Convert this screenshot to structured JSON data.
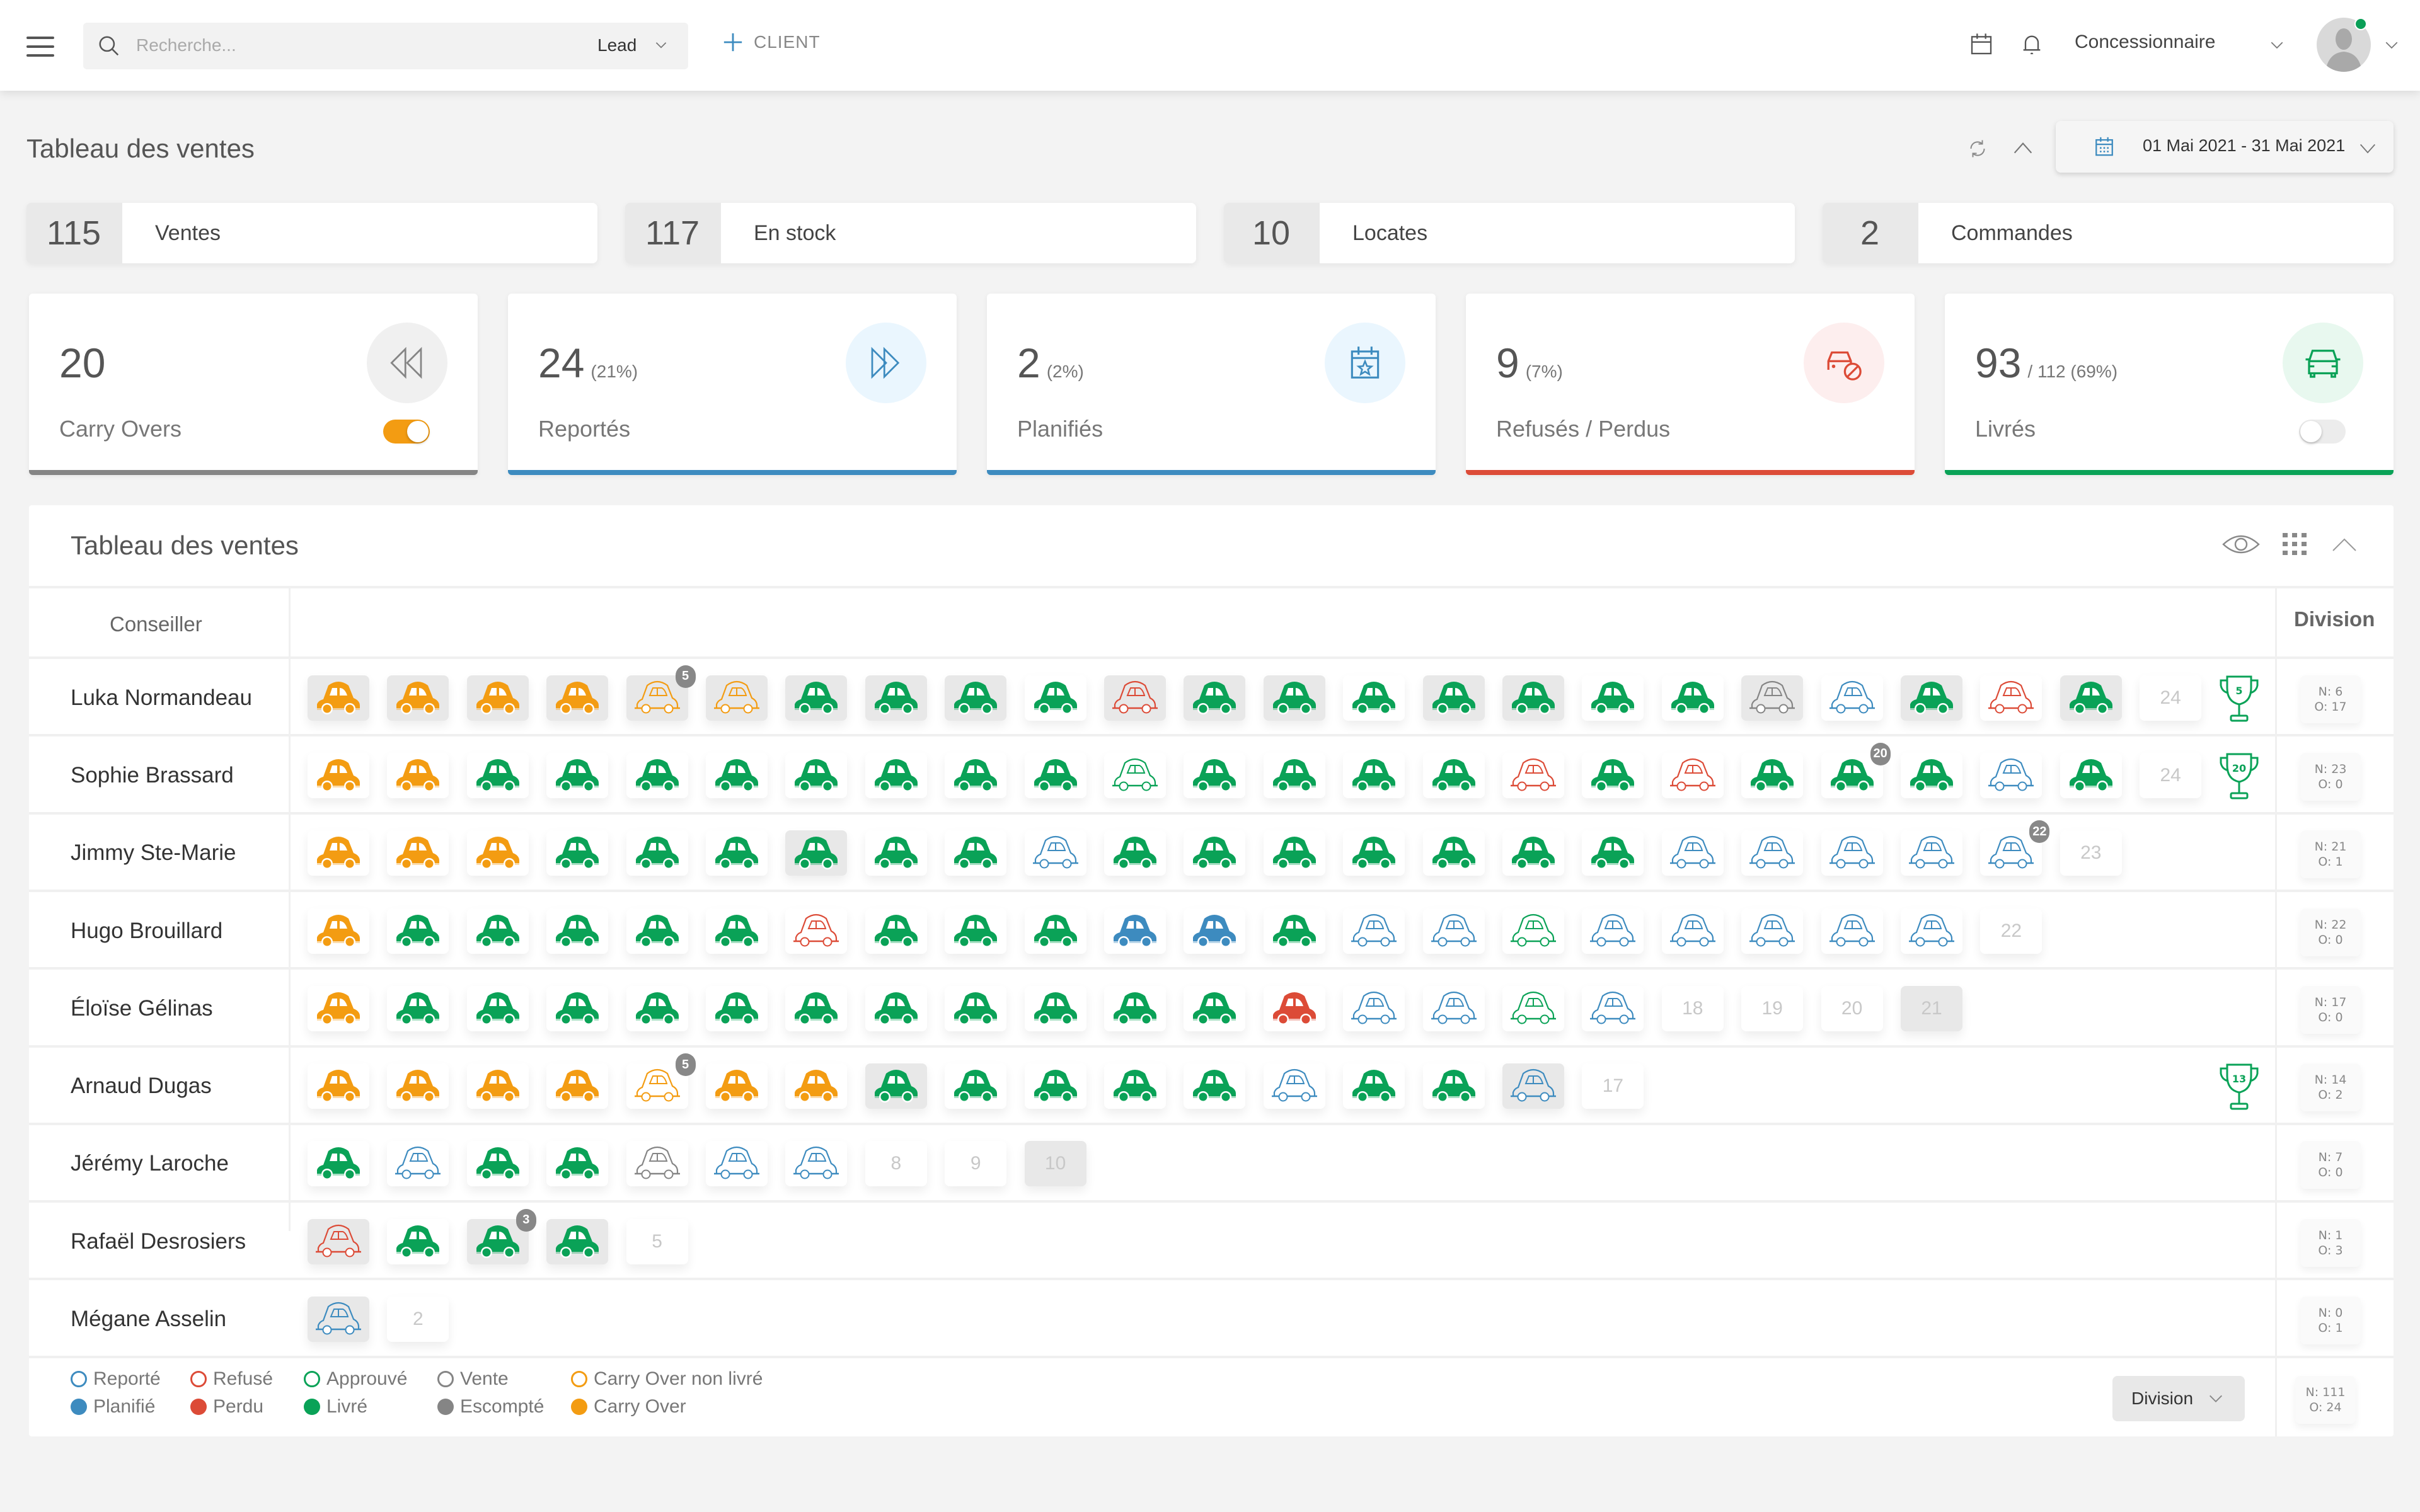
{
  "topbar": {
    "search_placeholder": "Recherche...",
    "search_type": "Lead",
    "add_client_label": "CLIENT",
    "dealer_select": "Concessionnaire"
  },
  "header": {
    "title": "Tableau des ventes",
    "date_range": "01 Mai 2021 - 31 Mai 2021"
  },
  "stats": [
    {
      "value": "115",
      "label": "Ventes"
    },
    {
      "value": "117",
      "label": "En stock"
    },
    {
      "value": "10",
      "label": "Locates"
    },
    {
      "value": "2",
      "label": "Commandes"
    }
  ],
  "kpis": [
    {
      "value": "20",
      "sub": "",
      "label": "Carry Overs",
      "icon": "rewind-icon",
      "color": "#858585",
      "bg": "#f0f0f0",
      "toggle": true,
      "toggle_on": true
    },
    {
      "value": "24",
      "sub": "(21%)",
      "label": "Reportés",
      "icon": "fast-forward-icon",
      "color": "#3d8bbf",
      "bg": "#eaf6fe",
      "toggle": false
    },
    {
      "value": "2",
      "sub": "(2%)",
      "label": "Planifiés",
      "icon": "calendar-star-icon",
      "color": "#3d8bbf",
      "bg": "#eaf6fe",
      "toggle": false
    },
    {
      "value": "9",
      "sub": "(7%)",
      "label": "Refusés / Perdus",
      "icon": "car-cancel-icon",
      "color": "#dc4b37",
      "bg": "#fdeeee",
      "toggle": false
    },
    {
      "value": "93",
      "sub": "/ 112 (69%)",
      "label": "Livrés",
      "icon": "car-front-icon",
      "color": "#0aa257",
      "bg": "#e8f8ef",
      "toggle": true,
      "toggle_on": false
    }
  ],
  "panel": {
    "title": "Tableau des ventes",
    "col_advisor": "Conseiller",
    "col_division": "Division",
    "division_select": "Division"
  },
  "colors": {
    "blue": "#3d8bbf",
    "red": "#dc4b37",
    "green": "#0aa257",
    "gray": "#858585",
    "orange": "#f39c12"
  },
  "legend": [
    {
      "label": "Reporté",
      "color": "blue",
      "filled": false
    },
    {
      "label": "Planifié",
      "color": "blue",
      "filled": true
    },
    {
      "label": "Refusé",
      "color": "red",
      "filled": false
    },
    {
      "label": "Perdu",
      "color": "red",
      "filled": true
    },
    {
      "label": "Approuvé",
      "color": "green",
      "filled": false
    },
    {
      "label": "Livré",
      "color": "green",
      "filled": true
    },
    {
      "label": "Vente",
      "color": "gray",
      "filled": false
    },
    {
      "label": "Escompté",
      "color": "gray",
      "filled": true
    },
    {
      "label": "Carry Over non livré",
      "color": "orange",
      "filled": false
    },
    {
      "label": "Carry Over",
      "color": "orange",
      "filled": true
    }
  ],
  "rows": [
    {
      "name": "Luka Normandeau",
      "division": {
        "n": "N: 6",
        "o": "O: 17"
      },
      "trophy": "5",
      "next": "24",
      "cars": [
        "O*",
        "O*",
        "O*",
        "O*",
        "o*|5",
        "o*",
        "G*",
        "G*",
        "G*",
        "G",
        "r*",
        "G*",
        "G*",
        "G",
        "G*",
        "G*",
        "G",
        "G",
        "v*",
        "b",
        "G*",
        "r",
        "G*"
      ]
    },
    {
      "name": "Sophie Brassard",
      "division": {
        "n": "N: 23",
        "o": "O: 0"
      },
      "trophy": "20",
      "next": "24",
      "cars": [
        "O",
        "O",
        "G",
        "G",
        "G",
        "G",
        "G",
        "G",
        "G",
        "G",
        "g",
        "G",
        "G",
        "G",
        "G",
        "r",
        "G",
        "r",
        "G",
        "G|20",
        "G",
        "b",
        "G"
      ]
    },
    {
      "name": "Jimmy Ste-Marie",
      "division": {
        "n": "N: 21",
        "o": "O: 1"
      },
      "trophy": "",
      "next": "23",
      "cars": [
        "O",
        "O",
        "O",
        "G",
        "G",
        "G",
        "G*",
        "G",
        "G",
        "b",
        "G",
        "G",
        "G",
        "G",
        "G",
        "G",
        "G",
        "b",
        "b",
        "b",
        "b",
        "b|22"
      ]
    },
    {
      "name": "Hugo Brouillard",
      "division": {
        "n": "N: 22",
        "o": "O: 0"
      },
      "trophy": "",
      "next": "22",
      "cars": [
        "O",
        "G",
        "G",
        "G",
        "G",
        "G",
        "r",
        "G",
        "G",
        "G",
        "B",
        "B",
        "G",
        "b",
        "b",
        "g",
        "b",
        "b",
        "b",
        "b",
        "b"
      ]
    },
    {
      "name": "Éloïse Gélinas",
      "division": {
        "n": "N: 17",
        "o": "O: 0"
      },
      "trophy": "",
      "next": "18",
      "cars": [
        "O",
        "G",
        "G",
        "G",
        "G",
        "G",
        "G",
        "G",
        "G",
        "G",
        "G",
        "G",
        "R",
        "b",
        "b",
        "g",
        "b"
      ],
      "extra": [
        "19",
        "20",
        "21*"
      ]
    },
    {
      "name": "Arnaud Dugas",
      "division": {
        "n": "N: 14",
        "o": "O: 2"
      },
      "trophy": "13",
      "next": "17",
      "cars": [
        "O",
        "O",
        "O",
        "O",
        "o|5",
        "O",
        "O",
        "G*",
        "G",
        "G",
        "G",
        "G",
        "b",
        "G",
        "G",
        "b*"
      ]
    },
    {
      "name": "Jérémy Laroche",
      "division": {
        "n": "N: 7",
        "o": "O: 0"
      },
      "trophy": "",
      "next": "8",
      "cars": [
        "G",
        "b",
        "G",
        "G",
        "v",
        "b",
        "b"
      ],
      "extra": [
        "9",
        "10*"
      ]
    },
    {
      "name": "Rafaël Desrosiers",
      "division": {
        "n": "N: 1",
        "o": "O: 3"
      },
      "trophy": "",
      "next": "5",
      "cars": [
        "r*",
        "G",
        "G*|3",
        "G*"
      ]
    },
    {
      "name": "Mégane Asselin",
      "division": {
        "n": "N: 0",
        "o": "O: 1"
      },
      "trophy": "",
      "next": "2",
      "cars": [
        "b*"
      ]
    }
  ],
  "totals": {
    "n": "N: 111",
    "o": "O: 24"
  }
}
